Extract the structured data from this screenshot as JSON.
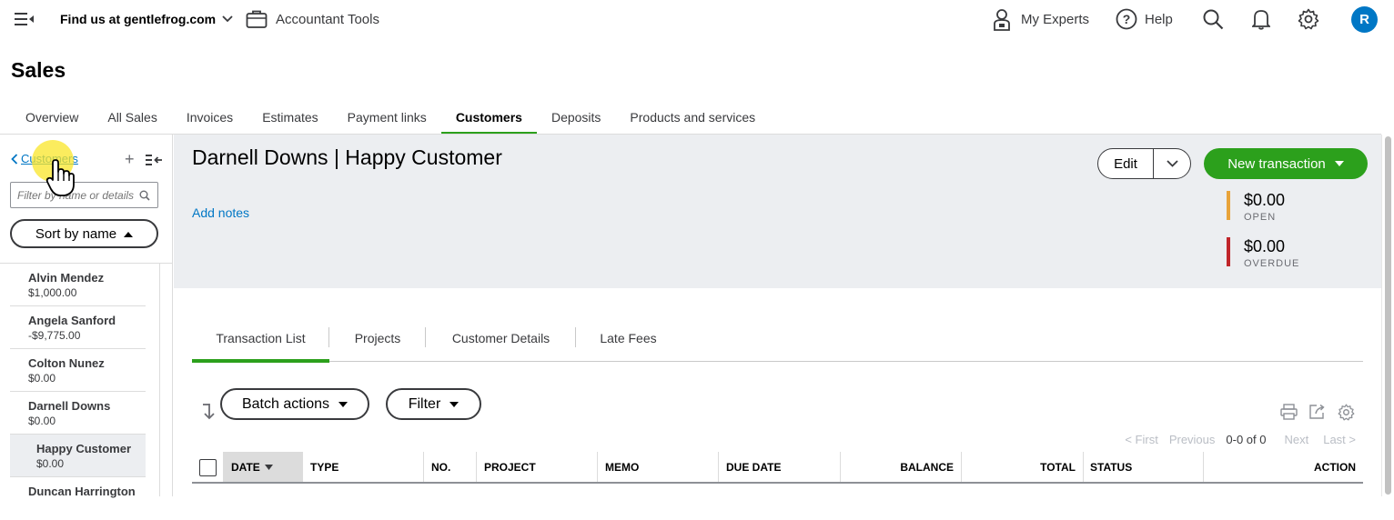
{
  "topbar": {
    "company_label": "Find us at gentlefrog.com",
    "accountant_tools": "Accountant Tools",
    "my_experts": "My Experts",
    "help": "Help",
    "avatar_initial": "R"
  },
  "page": {
    "title": "Sales"
  },
  "tabs": [
    {
      "label": "Overview"
    },
    {
      "label": "All Sales"
    },
    {
      "label": "Invoices"
    },
    {
      "label": "Estimates"
    },
    {
      "label": "Payment links"
    },
    {
      "label": "Customers",
      "active": true
    },
    {
      "label": "Deposits"
    },
    {
      "label": "Products and services"
    }
  ],
  "left_panel": {
    "back_label": "Customers",
    "filter_placeholder": "Filter by name or details",
    "sort_label": "Sort by name",
    "customers": [
      {
        "name": "Alvin Mendez",
        "amount": "$1,000.00"
      },
      {
        "name": "Angela Sanford",
        "amount": "-$9,775.00"
      },
      {
        "name": "Colton Nunez",
        "amount": "$0.00"
      },
      {
        "name": "Darnell Downs",
        "amount": "$0.00"
      },
      {
        "name": "Happy Customer",
        "amount": "$0.00",
        "sub": true
      },
      {
        "name": "Duncan Harrington",
        "amount": ""
      }
    ]
  },
  "customer": {
    "title": "Darnell Downs | Happy Customer",
    "add_notes": "Add notes",
    "edit_label": "Edit",
    "new_transaction_label": "New transaction",
    "open_amount": "$0.00",
    "open_label": "OPEN",
    "overdue_amount": "$0.00",
    "overdue_label": "OVERDUE",
    "colors": {
      "open": "#e8a33a",
      "overdue": "#c0252a",
      "primary": "#2ca01c",
      "link": "#0077c5"
    }
  },
  "detail_tabs": [
    {
      "label": "Transaction List",
      "active": true
    },
    {
      "label": "Projects"
    },
    {
      "label": "Customer Details"
    },
    {
      "label": "Late Fees"
    }
  ],
  "toolbar": {
    "batch_actions": "Batch actions",
    "filter": "Filter"
  },
  "pager": {
    "first": "< First",
    "previous": "Previous",
    "count": "0-0 of 0",
    "next": "Next",
    "last": "Last >"
  },
  "table": {
    "columns": [
      "DATE",
      "TYPE",
      "NO.",
      "PROJECT",
      "MEMO",
      "DUE DATE",
      "BALANCE",
      "TOTAL",
      "STATUS",
      "ACTION"
    ]
  },
  "icons": [
    "menu-collapse-icon",
    "chevron-down-icon",
    "briefcase-icon",
    "person-lock-icon",
    "help-circle-icon",
    "search-icon",
    "bell-icon",
    "gear-icon",
    "chevron-left-icon",
    "plus-icon",
    "collapse-panel-icon",
    "sort-arrow-icon",
    "print-icon",
    "export-icon",
    "settings-icon",
    "hand-cursor-icon"
  ]
}
